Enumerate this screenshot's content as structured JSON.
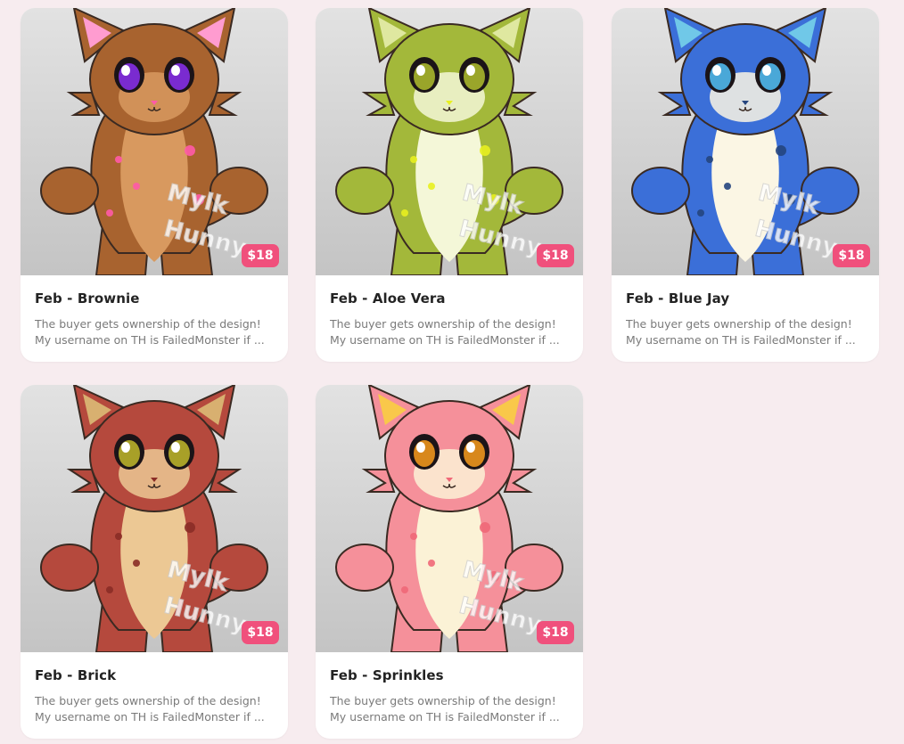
{
  "colors": {
    "background": "#f7ecef",
    "card": "#ffffff",
    "price_badge": "#f0507c",
    "title_text": "#232323",
    "desc_text": "#7a7a7a"
  },
  "cards": [
    {
      "title": "Feb - Brownie",
      "price": "$18",
      "desc_line1": "The buyer gets ownership of the design!",
      "desc_line2": "My username on TH is FailedMonster if ...",
      "watermark": [
        "Mylk",
        "Hunny"
      ],
      "palette": {
        "body": "#a8632f",
        "belly": "#d8995f",
        "eye": "#7a2bd0",
        "accent": "#ff5aa8",
        "ear": "#ff9cd0"
      }
    },
    {
      "title": "Feb - Aloe Vera",
      "price": "$18",
      "desc_line1": "The buyer gets ownership of the design!",
      "desc_line2": "My username on TH is FailedMonster if ...",
      "watermark": [
        "Mylk",
        "Hunny"
      ],
      "palette": {
        "body": "#a3b83a",
        "belly": "#f4f7d8",
        "eye": "#9aa52a",
        "accent": "#e8f020",
        "ear": "#dfe8a0"
      }
    },
    {
      "title": "Feb - Blue Jay",
      "price": "$18",
      "desc_line1": "The buyer gets ownership of the design!",
      "desc_line2": "My username on TH is FailedMonster if ...",
      "watermark": [
        "Mylk",
        "Hunny"
      ],
      "palette": {
        "body": "#3b6fd8",
        "belly": "#fbf6e4",
        "eye": "#4aa8d8",
        "accent": "#25457e",
        "ear": "#70c8e8"
      }
    },
    {
      "title": "Feb - Brick",
      "price": "$18",
      "desc_line1": "The buyer gets ownership of the design!",
      "desc_line2": "My username on TH is FailedMonster if ...",
      "watermark": [
        "Mylk",
        "Hunny"
      ],
      "palette": {
        "body": "#b5493d",
        "belly": "#ecc894",
        "eye": "#a8a028",
        "accent": "#8a2c26",
        "ear": "#d8b070"
      }
    },
    {
      "title": "Feb - Sprinkles",
      "price": "$18",
      "desc_line1": "The buyer gets ownership of the design!",
      "desc_line2": "My username on TH is FailedMonster if ...",
      "watermark": [
        "Mylk",
        "Hunny"
      ],
      "palette": {
        "body": "#f5909a",
        "belly": "#fbf2d6",
        "eye": "#d8881c",
        "accent": "#f06878",
        "ear": "#f9c84a"
      }
    }
  ]
}
